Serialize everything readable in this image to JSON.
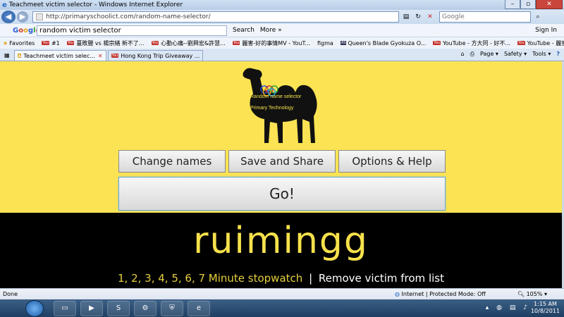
{
  "window": {
    "title": "Teachmeet victim selector - Windows Internet Explorer"
  },
  "address": {
    "url": "http://primaryschoolict.com/random-name-selector/",
    "search_placeholder": "Google"
  },
  "googlebar": {
    "query": "random victim selector",
    "search_label": "Search",
    "more_label": "More »",
    "signin_label": "Sign In"
  },
  "favorites": {
    "label": "Favorites",
    "items": [
      "#1",
      "蔓敗鹽 vs 楊宗緒 新不了...",
      "心動心痛--劉興宏&許慧...",
      "麗害-好的事情MV - YouT...",
      "figma",
      "Queen's Blade Gyokuza O...",
      "YouTube - 方大同 - 好不...",
      "YouTube - 麗害-好的事情..."
    ]
  },
  "tabs": [
    {
      "label": "Teachmeet victim selec..."
    },
    {
      "label": "Hong Kong Trip Giveaway ..."
    }
  ],
  "toolbar": {
    "page": "Page ▾",
    "safety": "Safety ▾",
    "tools": "Tools ▾",
    "help": "?"
  },
  "camel": {
    "line1": "Random name selector",
    "line2": "Primary Technology"
  },
  "buttons": {
    "change": "Change names",
    "save": "Save and Share",
    "options": "Options & Help",
    "go": "Go!"
  },
  "result": {
    "name": "ruimingg"
  },
  "links": {
    "stopwatch": "1, 2, 3, 4, 5, 6, 7 Minute stopwatch",
    "separator": "|",
    "remove": "Remove victim from list"
  },
  "status": {
    "left": "Done",
    "zone": "Internet | Protected Mode: Off",
    "zoom": "105%"
  },
  "clock": {
    "time": "1:15 AM",
    "date": "10/8/2011"
  },
  "colors": {
    "yellow": "#fbe353",
    "name_text": "#f6e14b",
    "black": "#000000"
  }
}
